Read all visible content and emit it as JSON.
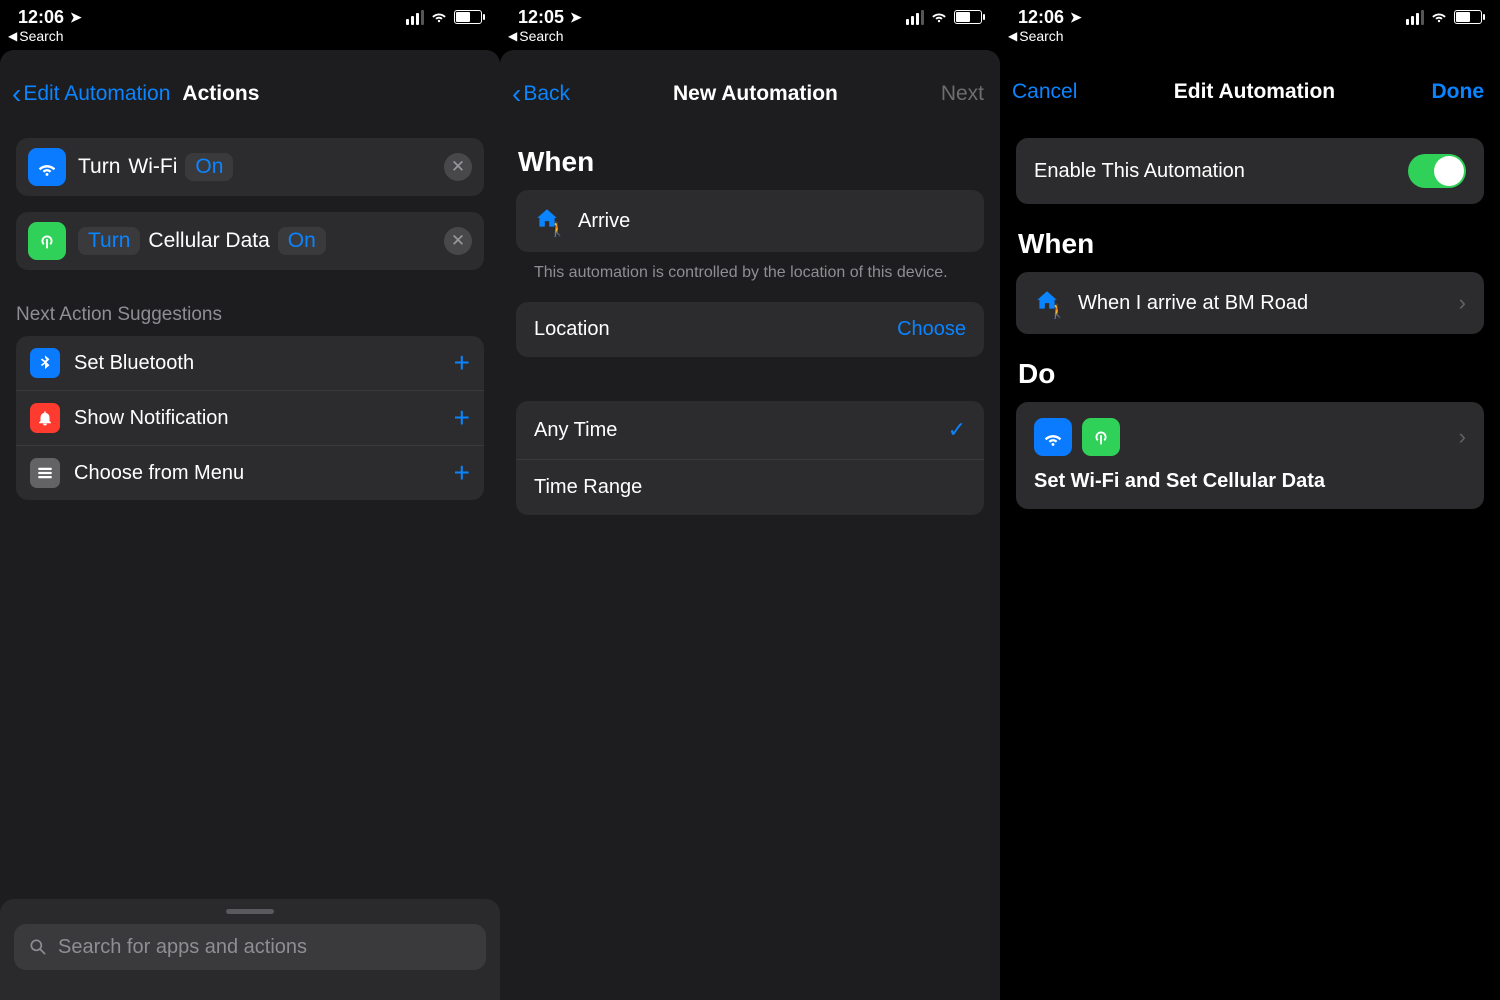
{
  "screen1": {
    "status": {
      "time": "12:06",
      "back_app": "Search"
    },
    "nav": {
      "back": "Edit Automation",
      "title": "Actions"
    },
    "actions": [
      {
        "icon": "wifi-icon",
        "icon_color": "blue",
        "verb": "Turn",
        "object": "Wi-Fi",
        "state": "On"
      },
      {
        "icon": "cellular-icon",
        "icon_color": "green",
        "verb": "Turn",
        "object": "Cellular Data",
        "state": "On"
      }
    ],
    "suggestions_header": "Next Action Suggestions",
    "suggestions": [
      {
        "icon": "bluetooth-icon",
        "icon_color": "blue",
        "label": "Set Bluetooth"
      },
      {
        "icon": "bell-icon",
        "icon_color": "red",
        "label": "Show Notification"
      },
      {
        "icon": "menu-icon",
        "icon_color": "gray",
        "label": "Choose from Menu"
      }
    ],
    "search_placeholder": "Search for apps and actions"
  },
  "screen2": {
    "status": {
      "time": "12:05",
      "back_app": "Search"
    },
    "nav": {
      "back": "Back",
      "title": "New Automation",
      "right": "Next",
      "right_disabled": true
    },
    "when_header": "When",
    "trigger_label": "Arrive",
    "trigger_footnote": "This automation is controlled by the location of this device.",
    "location_label": "Location",
    "location_value": "Choose",
    "time_options": [
      {
        "label": "Any Time",
        "selected": true
      },
      {
        "label": "Time Range",
        "selected": false
      }
    ]
  },
  "screen3": {
    "status": {
      "time": "12:06",
      "back_app": "Search"
    },
    "nav": {
      "left": "Cancel",
      "title": "Edit Automation",
      "right": "Done"
    },
    "enable_label": "Enable This Automation",
    "enable_on": true,
    "when_header": "When",
    "when_label": "When I arrive at BM Road",
    "do_header": "Do",
    "do_label": "Set Wi-Fi and Set Cellular Data"
  }
}
